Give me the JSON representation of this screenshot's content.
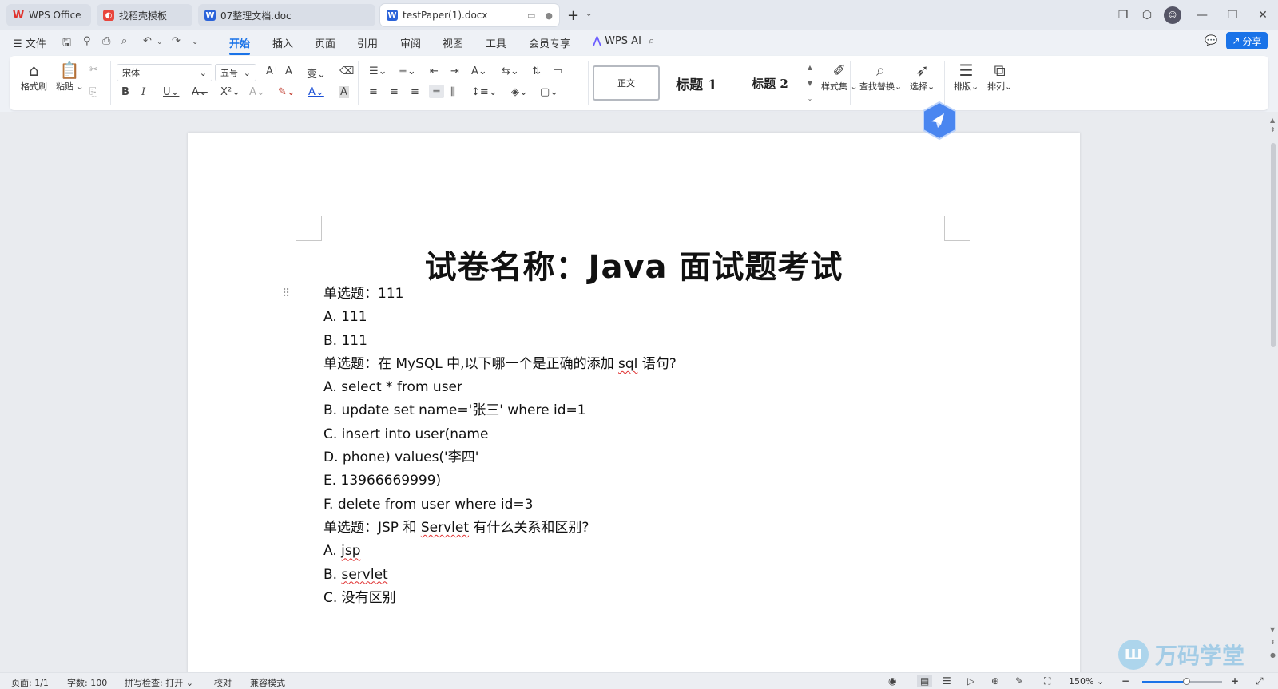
{
  "tabs": [
    {
      "label": "WPS Office",
      "icon": "wps-logo-icon"
    },
    {
      "label": "找稻壳模板",
      "icon": "docer-icon"
    },
    {
      "label": "07整理文档.doc",
      "icon": "word-doc-icon"
    },
    {
      "label": "testPaper(1).docx",
      "icon": "word-doc-icon"
    }
  ],
  "menu": {
    "file": "文件",
    "items": [
      "开始",
      "插入",
      "页面",
      "引用",
      "审阅",
      "视图",
      "工具",
      "会员专享"
    ],
    "active": "开始",
    "ai": "WPS AI",
    "share": "分享"
  },
  "ribbon": {
    "format_painter": "格式刷",
    "paste": "粘贴",
    "font_name": "宋体",
    "font_size": "五号",
    "styles": {
      "normal": "正文",
      "h1": "标题 1",
      "h2": "标题 2"
    },
    "style_set": "样式集",
    "find_replace": "查找替换",
    "select": "选择",
    "layout": "排版",
    "arrange": "排列"
  },
  "document": {
    "title": "试卷名称：Java 面试题考试",
    "lines": [
      "单选题：111",
      "A. 111",
      "B. 111",
      "单选题：在 MySQL 中,以下哪一个是正确的添加 sql 语句?",
      "A. select * from user",
      "B. update set name='张三'    where id=1",
      "C. insert into user(name",
      "D. phone) values('李四'",
      "E. 13966669999)",
      "F. delete from user where id=3",
      "单选题：JSP 和 Servlet 有什么关系和区别?",
      "A. jsp",
      "B. servlet",
      "C.  没有区别"
    ]
  },
  "watermark": "万码学堂",
  "status": {
    "page": "页面: 1/1",
    "words": "字数: 100",
    "spell": "拼写检查: 打开",
    "proof": "校对",
    "compat": "兼容模式",
    "zoom": "150%",
    "zoom_fraction": 0.55
  },
  "colors": {
    "accent": "#1a73e8",
    "wps_red": "#e0312b",
    "word_blue": "#2b63d9"
  }
}
